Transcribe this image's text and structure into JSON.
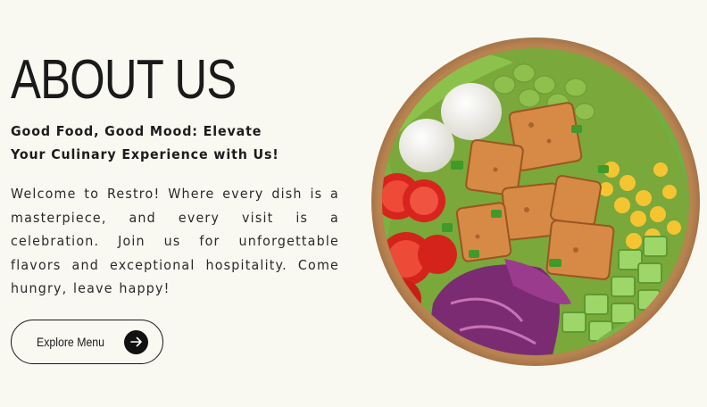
{
  "about": {
    "title": "ABOUT US",
    "tagline": "Good Food, Good Mood: Elevate Your Culinary Experience with Us!",
    "intro": "Welcome to Restro! Where every dish is a masterpiece, and every visit is a celebration. Join us for unforgettable flavors and exceptional hospitality. Come hungry, leave happy!",
    "cta_label": "Explore Menu",
    "cta_icon": "arrow-right-icon"
  },
  "image": {
    "subject": "salad-bowl-image"
  },
  "colors": {
    "background": "#f9f9f2",
    "text": "#1c1c1c",
    "button_border": "#1a1a1a",
    "icon_circle": "#111111"
  }
}
